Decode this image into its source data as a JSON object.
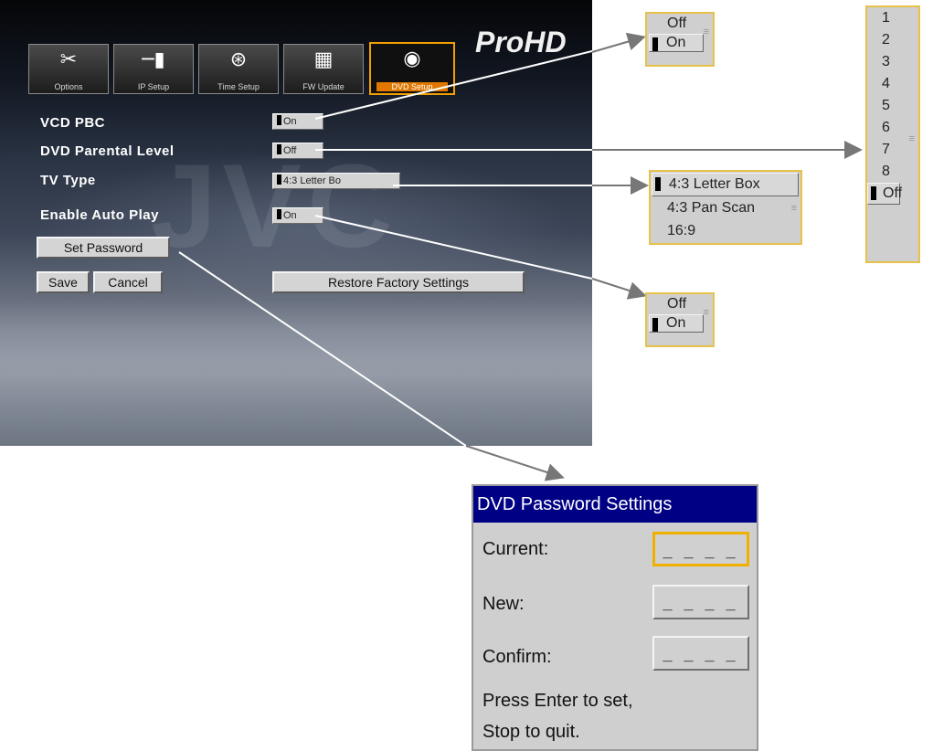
{
  "brand": {
    "text": "ProHD"
  },
  "tabs": [
    {
      "icon": "tools-icon",
      "glyph": "✂",
      "label": "Options"
    },
    {
      "icon": "ip-setup-icon",
      "glyph": "─▮",
      "label": "IP Setup"
    },
    {
      "icon": "clock-icon",
      "glyph": "⊛",
      "label": "Time Setup"
    },
    {
      "icon": "chip-icon",
      "glyph": "▦",
      "label": "FW Update"
    },
    {
      "icon": "disc-icon",
      "glyph": "◉",
      "label": "DVD Setup",
      "active": true
    }
  ],
  "settings": {
    "vcd_pbc": {
      "label": "VCD PBC",
      "value": "On"
    },
    "parental": {
      "label": "DVD Parental Level",
      "value": "Off"
    },
    "tv_type": {
      "label": "TV Type",
      "value": "4:3 Letter Bo"
    },
    "auto_play": {
      "label": "Enable Auto Play",
      "value": "On"
    }
  },
  "buttons": {
    "set_password": "Set Password",
    "save": "Save",
    "cancel": "Cancel",
    "restore": "Restore Factory Settings"
  },
  "popups": {
    "vcd_pbc": {
      "options": [
        "Off",
        "On"
      ],
      "selected": "On"
    },
    "parental": {
      "options": [
        "1",
        "2",
        "3",
        "4",
        "5",
        "6",
        "7",
        "8",
        "Off"
      ],
      "selected": "Off"
    },
    "tv_type": {
      "options": [
        "4:3 Letter Box",
        "4:3 Pan Scan",
        "16:9"
      ],
      "selected": "4:3 Letter Box"
    },
    "auto_play": {
      "options": [
        "Off",
        "On"
      ],
      "selected": "On"
    }
  },
  "password_dialog": {
    "title": "DVD Password Settings",
    "current_label": "Current:",
    "new_label": "New:",
    "confirm_label": "Confirm:",
    "current_value": "_ _ _ _",
    "new_value": "_ _ _ _",
    "confirm_value": "_ _ _ _",
    "help_line1": "Press Enter to set,",
    "help_line2": "Stop to quit."
  },
  "colors": {
    "active_tab": "#f0a000",
    "dialog_title": "#000084",
    "callout_line": "#ffffff",
    "callout_arrow": "#777777"
  }
}
